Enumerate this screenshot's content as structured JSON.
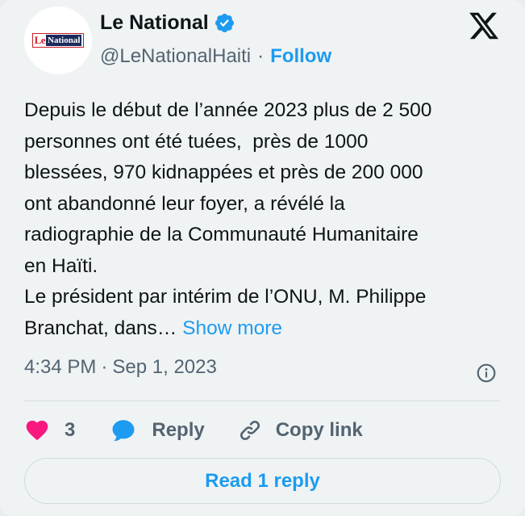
{
  "author": {
    "display_name": "Le National",
    "handle": "@LeNationalHaiti",
    "separator": "·",
    "follow_label": "Follow",
    "logo_text_le": "Le",
    "logo_text_national": "National"
  },
  "tweet": {
    "text": "Depuis le début de l’année 2023 plus de 2 500\npersonnes ont été tuées,  près de 1000\nblessées, 970 kidnappées et près de 200 000\nont abandonné leur foyer, a révélé la\nradiographie de la Communauté Humanitaire\nen Haïti.\nLe président par intérim de l’ONU, M. Philippe\nBranchat, dans…",
    "show_more_label": "Show more",
    "time": "4:34 PM",
    "date_separator": "·",
    "date": "Sep 1, 2023"
  },
  "actions": {
    "like_count": "3",
    "reply_label": "Reply",
    "copy_link_label": "Copy link"
  },
  "read_replies_label": "Read 1 reply",
  "colors": {
    "accent": "#1d9bf0",
    "like": "#f91880",
    "muted": "#536471",
    "card_bg": "#f0f3f4"
  },
  "icons": [
    "verified-badge-icon",
    "x-logo-icon",
    "info-icon",
    "heart-icon",
    "reply-bubble-icon",
    "link-icon"
  ]
}
